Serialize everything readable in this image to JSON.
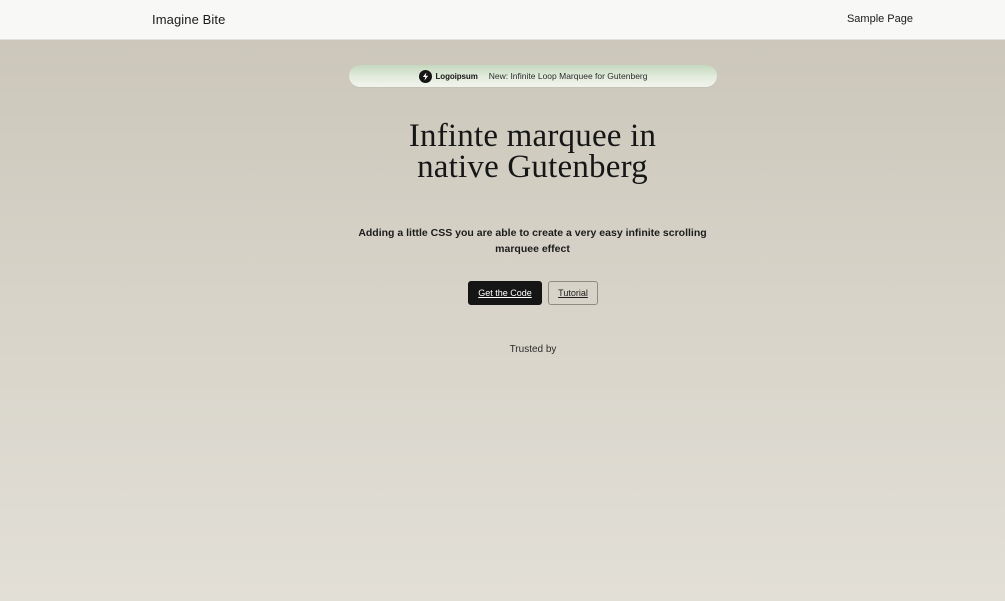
{
  "header": {
    "site_title": "Imagine Bite",
    "nav": [
      {
        "label": "Sample Page"
      }
    ]
  },
  "announcement": {
    "logo_icon": "lightning-bolt-icon",
    "logo_text": "Logoipsum",
    "text": "New: Infinite Loop Marquee for Gutenberg"
  },
  "hero": {
    "title_line1": "Infinte marquee in",
    "title_line2": "native Gutenberg",
    "subtitle": "Adding a little CSS you are able to create a very easy infinite scrolling marquee effect",
    "primary_button": "Get the Code",
    "secondary_button": "Tutorial",
    "trusted_label": "Trusted by"
  },
  "colors": {
    "accent_dark": "#151515",
    "announcement_green": "#c5d8bf",
    "background_top": "#cac5b8",
    "background_bottom": "#e2dfd7"
  }
}
